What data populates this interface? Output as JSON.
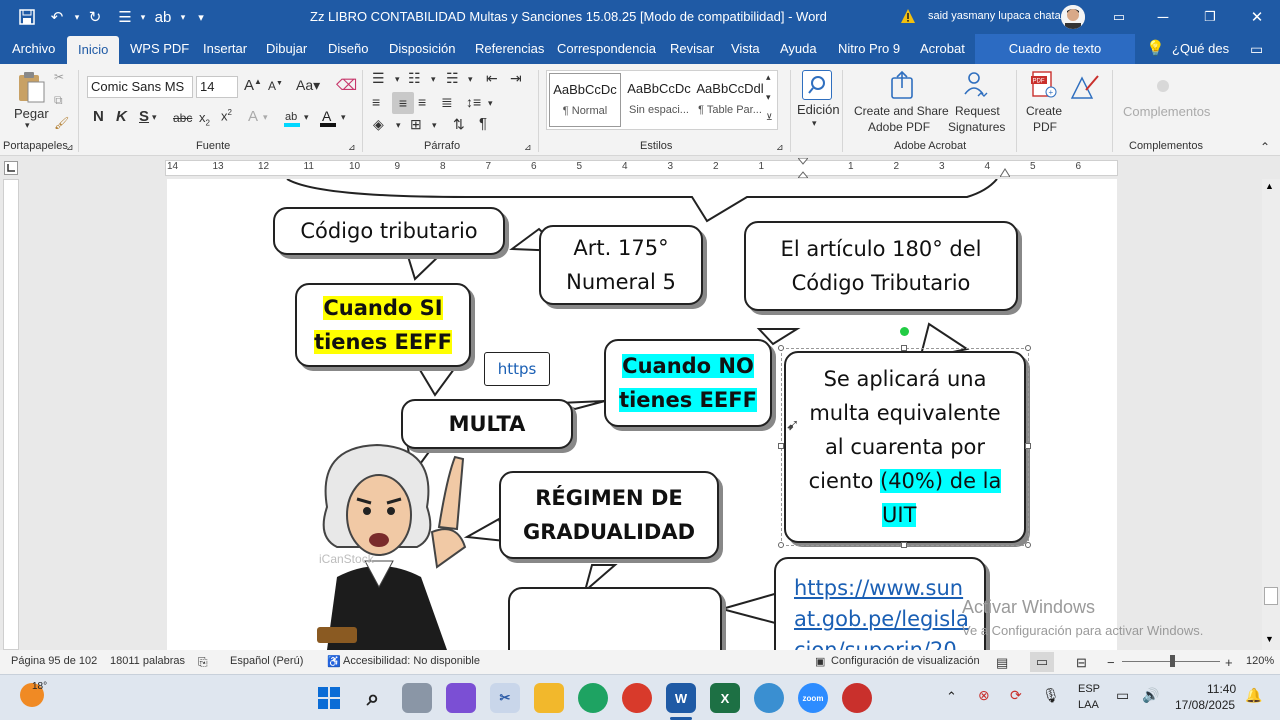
{
  "window": {
    "title": "Zz LIBRO CONTABILIDAD Multas y Sanciones 15.08.25 [Modo de compatibilidad]  -  Word",
    "user": "said yasmany lupaca chata"
  },
  "menu": {
    "tabs": [
      "Archivo",
      "Inicio",
      "WPS PDF",
      "Insertar",
      "Dibujar",
      "Diseño",
      "Disposición",
      "Referencias",
      "Correspondencia",
      "Revisar",
      "Vista",
      "Ayuda",
      "Nitro Pro 9",
      "Acrobat"
    ],
    "context_tab": "Cuadro de texto",
    "search": "¿Qué des"
  },
  "ribbon": {
    "clipboard": {
      "paste": "Pegar",
      "label": "Portapapeles"
    },
    "font": {
      "family": "Comic Sans MS",
      "size": "14",
      "label": "Fuente"
    },
    "paragraph": {
      "label": "Párrafo"
    },
    "styles": {
      "label": "Estilos",
      "items": [
        {
          "preview": "AaBbCcDc",
          "name": "¶ Normal"
        },
        {
          "preview": "AaBbCcDc",
          "name": "Sin espaci..."
        },
        {
          "preview": "AaBbCcDdl",
          "name": "¶ Table Par..."
        }
      ]
    },
    "editing": {
      "label": "Edición"
    },
    "acrobat": {
      "create_share": "Create and Share",
      "adobe_pdf": "Adobe PDF",
      "request": "Request",
      "signatures": "Signatures",
      "label": "Adobe Acrobat"
    },
    "create_pdf": {
      "create": "Create",
      "pdf": "PDF"
    },
    "addins": {
      "button": "Complementos",
      "label": "Complementos"
    }
  },
  "ruler": {
    "numbers": [
      "14",
      "13",
      "12",
      "11",
      "10",
      "9",
      "8",
      "7",
      "6",
      "5",
      "4",
      "3",
      "2",
      "1",
      "1",
      "2",
      "3",
      "4",
      "5",
      "6"
    ]
  },
  "document": {
    "bubbles": {
      "codigo": "Código tributario",
      "art175_1": "Art. 175°",
      "art175_2": "Numeral 5",
      "art180_1": "El artículo 180° del",
      "art180_2": "Código Tributario",
      "si_1": "Cuando SI",
      "si_2": "tienes EEFF",
      "https": "https",
      "no_1": "Cuando NO",
      "no_2": "tienes EEFF",
      "multa": "MULTA",
      "se_1": "Se aplicará una",
      "se_2": "multa equivalente",
      "se_3": "al cuarenta por",
      "se_4a": "ciento ",
      "se_4b": "(40%) de la",
      "se_5": "UIT",
      "regimen_1": "RÉGIMEN DE",
      "regimen_2": "GRADUALIDAD",
      "link_1": "https://www.sun",
      "link_2": "at.gob.pe/legisla",
      "link_3": "cion/superin/20"
    },
    "image_watermark": "iCanStock"
  },
  "watermark": {
    "line1": "Activar Windows",
    "line2": "Ve a Configuración para activar Windows."
  },
  "status": {
    "page": "Página 95 de 102",
    "words": "18011 palabras",
    "language": "Español (Perú)",
    "accessibility": "Accesibilidad: No disponible",
    "display": "Configuración de visualización",
    "zoom": "120%"
  },
  "taskbar": {
    "weather": "18°",
    "lang1": "ESP",
    "lang2": "LAA",
    "time": "11:40",
    "date": "17/08/2025"
  },
  "colors": {
    "word_blue": "#1f5aa5",
    "highlight_yellow": "#ffff00",
    "highlight_cyan": "#00ffff",
    "link_blue": "#1a5fb4"
  }
}
